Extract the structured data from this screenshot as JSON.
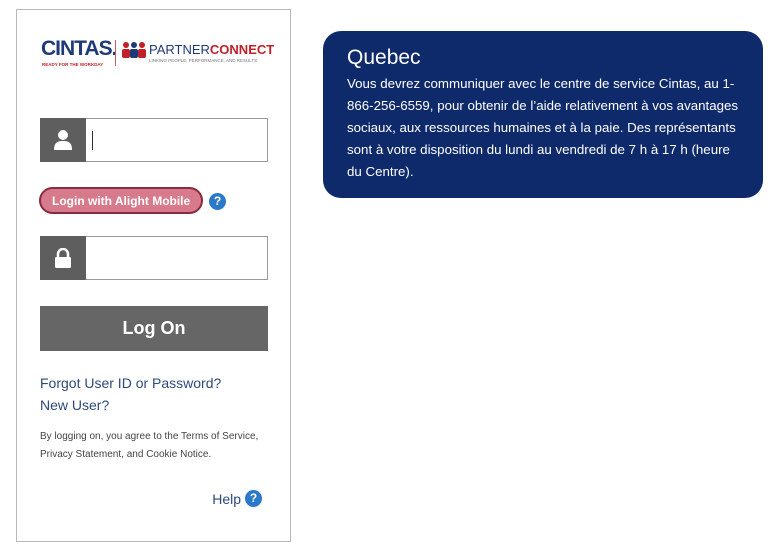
{
  "logo": {
    "cintas_text": "CINTAS.",
    "cintas_tagline": "READY FOR THE WORKDAY",
    "pc_partner": "PARTNER",
    "pc_connect": "CONNECT",
    "pc_tagline": "LINKING PEOPLE, PERFORMANCE, AND RESULTS"
  },
  "login": {
    "user_icon": "user-icon",
    "user_value": "",
    "alight_button": "Login with Alight Mobile",
    "help_glyph": "?",
    "lock_icon": "lock-icon",
    "password_value": "",
    "logon_button": "Log On",
    "forgot_link": "Forgot User ID or Password?",
    "new_user_link": "New User?",
    "terms_prefix": "By logging on, you agree to the",
    "terms_link": "Terms of Service",
    "privacy_link": "Privacy Statement",
    "and_text": ", and",
    "cookie_link": "Cookie Notice",
    "help_label": "Help"
  },
  "info": {
    "title": "Quebec",
    "body": "Vous devrez communiquer avec le centre de service Cintas, au 1-866-256-6559, pour obtenir de l’aide relativement à vos avantages sociaux, aux ressources humaines et à la paie. Des représentants sont à votre disposition du lundi au vendredi de 7 h à 17 h (heure du Centre)."
  },
  "colors": {
    "info_bg": "#0f2a6b",
    "alight_btn": "#d67a8c",
    "logon_btn": "#666666",
    "help_blue": "#2c79c9"
  }
}
